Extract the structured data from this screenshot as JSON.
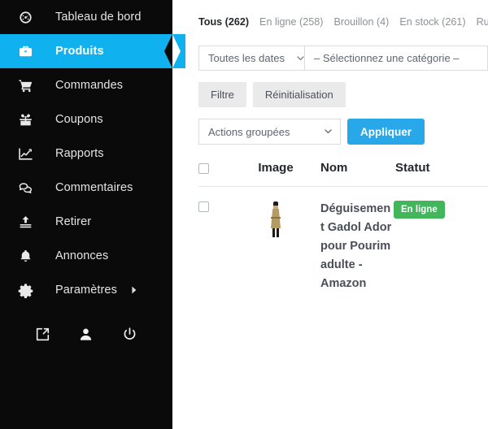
{
  "sidebar": {
    "items": [
      {
        "label": "Tableau de bord",
        "icon": "gauge-icon",
        "key": "dashboard",
        "active": false,
        "caret": false
      },
      {
        "label": "Produits",
        "icon": "briefcase-icon",
        "key": "products",
        "active": true,
        "caret": false
      },
      {
        "label": "Commandes",
        "icon": "cart-icon",
        "key": "orders",
        "active": false,
        "caret": false
      },
      {
        "label": "Coupons",
        "icon": "gift-icon",
        "key": "coupons",
        "active": false,
        "caret": false
      },
      {
        "label": "Rapports",
        "icon": "chart-line-icon",
        "key": "reports",
        "active": false,
        "caret": false
      },
      {
        "label": "Commentaires",
        "icon": "comment-icon",
        "key": "comments",
        "active": false,
        "caret": false
      },
      {
        "label": "Retirer",
        "icon": "upload-icon",
        "key": "withdraw",
        "active": false,
        "caret": false
      },
      {
        "label": "Annonces",
        "icon": "bell-icon",
        "key": "announcements",
        "active": false,
        "caret": false
      },
      {
        "label": "Paramètres",
        "icon": "gear-icon",
        "key": "settings",
        "active": false,
        "caret": true
      }
    ],
    "bottom_icons": [
      {
        "name": "external-link-icon"
      },
      {
        "name": "user-icon"
      },
      {
        "name": "power-icon"
      }
    ],
    "active_color": "#0fb2ef",
    "background_color": "#0a0a0a"
  },
  "main": {
    "tabs": [
      {
        "label": "Tous (262)",
        "active": true
      },
      {
        "label": "En ligne (258)",
        "active": false
      },
      {
        "label": "Brouillon (4)",
        "active": false
      },
      {
        "label": "En stock (261)",
        "active": false
      },
      {
        "label": "Rupture de",
        "active": false
      }
    ],
    "filters": {
      "date_select_value": "Toutes les dates",
      "category_select_value": "– Sélectionnez une catégorie –",
      "filter_button_label": "Filtre",
      "reset_button_label": "Réinitialisation"
    },
    "bulk": {
      "select_value": "Actions groupées",
      "apply_label": "Appliquer",
      "apply_color": "#28a8e8"
    },
    "table": {
      "headers": {
        "image": "Image",
        "name": "Nom",
        "status": "Statut"
      },
      "rows": [
        {
          "name": "Déguisement Gadol Ador pour Pourim adulte - Amazon",
          "status": "En ligne",
          "status_color": "#41b65a",
          "image_alt": "costume-thumbnail"
        }
      ]
    }
  }
}
